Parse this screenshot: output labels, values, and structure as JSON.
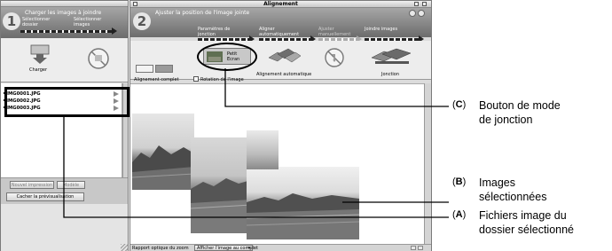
{
  "left_panel": {
    "step_number": "1",
    "step_title": "Charger les images à joindre",
    "steps": [
      "Sélectionner dossier",
      "Sélectionner images"
    ],
    "load_label": "Charger",
    "files": [
      "IMG0001.JPG",
      "IMG0002.JPG",
      "IMG0003.JPG"
    ],
    "buttons": [
      "Nouvel impression",
      "Modèle"
    ],
    "hide_preview_label": "Cacher la prévisualisation"
  },
  "main_window": {
    "title": "Alignement",
    "step_number": "2",
    "step_title": "Ajuster la position de l'image jointe",
    "steps": [
      {
        "label": "Paramètres de jonction",
        "faint": false
      },
      {
        "label": "Aligner automatiquement",
        "faint": false
      },
      {
        "label": "Ajuster manuellement",
        "faint": true
      },
      {
        "label": "Joindre images",
        "faint": false
      }
    ],
    "join_mode_label": "Petit Ecran",
    "auto_align_label": "Alignement automatique",
    "join_label": "Jonction",
    "align_complete_label": "Alignement complet",
    "rotate_label": "Rotation de l'image",
    "zoom_label": "Rapport optique du zoom",
    "zoom_select": "Afficher l'image au complet"
  },
  "callouts": [
    {
      "letter": "C",
      "text": [
        "Bouton de mode",
        "de jonction"
      ]
    },
    {
      "letter": "B",
      "text": [
        "Images",
        "sélectionnées"
      ]
    },
    {
      "letter": "A",
      "text": [
        "Fichiers image du",
        "dossier sélectionné"
      ]
    }
  ],
  "colors": {
    "header_gradient_top": "#a6a6a6",
    "header_gradient_bottom": "#6c6c6c",
    "window_bg": "#dcdcdc"
  }
}
